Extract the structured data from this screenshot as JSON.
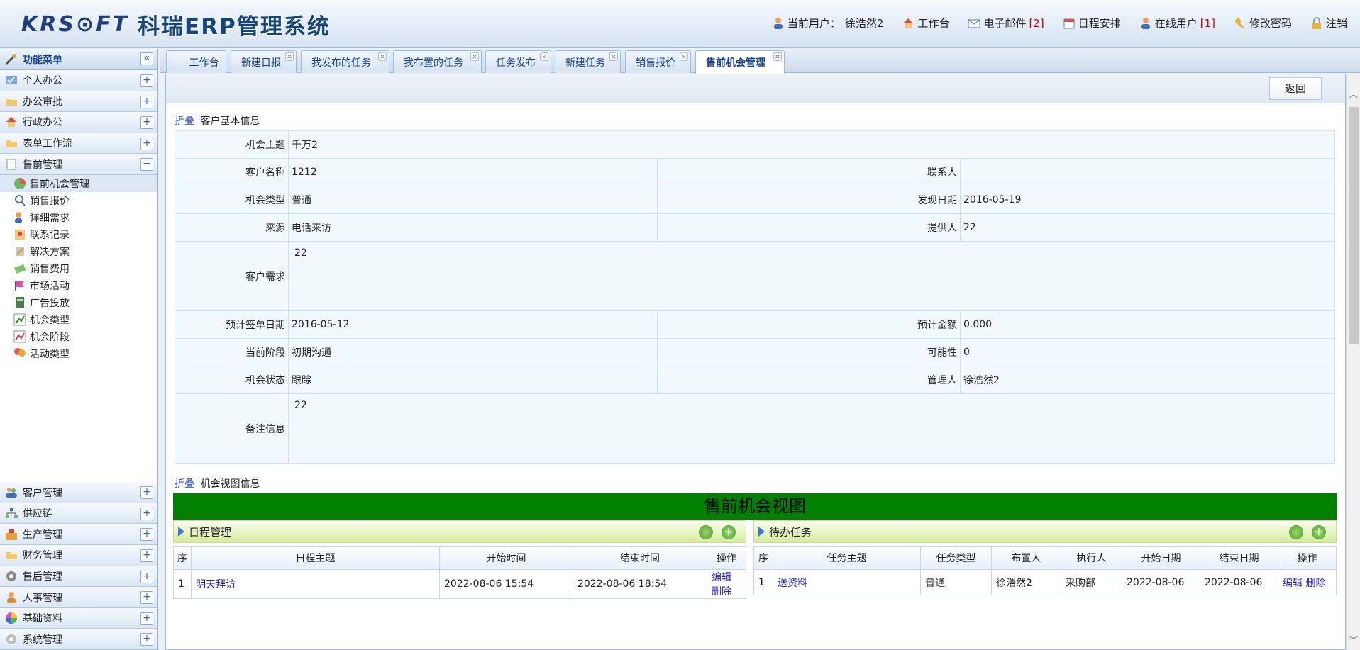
{
  "header": {
    "logo_en": "KRS⊙FT",
    "logo_cn": "科瑞ERP管理系统",
    "nav": {
      "current_user_label": "当前用户：",
      "current_user_name": "徐浩然2",
      "workbench": "工作台",
      "email": "电子邮件",
      "email_count": "[2]",
      "schedule": "日程安排",
      "online_users": "在线用户",
      "online_count": "[1]",
      "change_password": "修改密码",
      "logout": "注销"
    }
  },
  "sidebar": {
    "title": "功能菜单",
    "top_groups": [
      {
        "label": "个人办公",
        "toggle": "+"
      },
      {
        "label": "办公审批",
        "toggle": "+"
      },
      {
        "label": "行政办公",
        "toggle": "+"
      },
      {
        "label": "表单工作流",
        "toggle": "+"
      },
      {
        "label": "售前管理",
        "toggle": "−"
      }
    ],
    "presales_items": [
      "售前机会管理",
      "销售报价",
      "详细需求",
      "联系记录",
      "解决方案",
      "销售费用",
      "市场活动",
      "广告投放",
      "机会类型",
      "机会阶段",
      "活动类型"
    ],
    "bottom_groups": [
      {
        "label": "客户管理",
        "toggle": "+"
      },
      {
        "label": "供应链",
        "toggle": "+"
      },
      {
        "label": "生产管理",
        "toggle": "+"
      },
      {
        "label": "财务管理",
        "toggle": "+"
      },
      {
        "label": "售后管理",
        "toggle": "+"
      },
      {
        "label": "人事管理",
        "toggle": "+"
      },
      {
        "label": "基础资料",
        "toggle": "+"
      },
      {
        "label": "系统管理",
        "toggle": "+"
      }
    ]
  },
  "tabs": [
    "工作台",
    "新建日报",
    "我发布的任务",
    "我布置的任务",
    "任务发布",
    "新建任务",
    "销售报价",
    "售前机会管理"
  ],
  "toolbar": {
    "back_label": "返回"
  },
  "customer_section": {
    "fold_label": "折叠",
    "title": "客户基本信息",
    "fields": {
      "subject_label": "机会主题",
      "subject": "千万2",
      "customer_label": "客户名称",
      "customer": "1212",
      "contact_label": "联系人",
      "contact": "",
      "type_label": "机会类型",
      "type": "普通",
      "found_date_label": "发现日期",
      "found_date": "2016-05-19",
      "source_label": "来源",
      "source": "电话来访",
      "provider_label": "提供人",
      "provider": "22",
      "demand_label": "客户需求",
      "demand": "22",
      "sign_date_label": "预计签单日期",
      "sign_date": "2016-05-12",
      "amount_label": "预计金额",
      "amount": "0.000",
      "stage_label": "当前阶段",
      "stage": "初期沟通",
      "possibility_label": "可能性",
      "possibility": "0",
      "status_label": "机会状态",
      "status": "跟踪",
      "manager_label": "管理人",
      "manager": "徐浩然2",
      "remark_label": "备注信息",
      "remark": "22"
    }
  },
  "view_section": {
    "fold_label": "折叠",
    "title": "机会视图信息",
    "banner": "售前机会视图",
    "schedule": {
      "title": "日程管理",
      "headers": [
        "序",
        "日程主题",
        "开始时间",
        "结束时间",
        "操作"
      ],
      "rows": [
        {
          "no": "1",
          "subject": "明天拜访",
          "start": "2022-08-06 15:54",
          "end": "2022-08-06 18:54",
          "edit": "编辑",
          "delete": "删除"
        }
      ]
    },
    "tasks": {
      "title": "待办任务",
      "headers": [
        "序",
        "任务主题",
        "任务类型",
        "布置人",
        "执行人",
        "开始日期",
        "结束日期",
        "操作"
      ],
      "rows": [
        {
          "no": "1",
          "subject": "送资料",
          "type": "普通",
          "assigner": "徐浩然2",
          "executor": "采购部",
          "start": "2022-08-06",
          "end": "2022-08-06",
          "edit": "编辑",
          "delete": "删除"
        }
      ]
    }
  }
}
